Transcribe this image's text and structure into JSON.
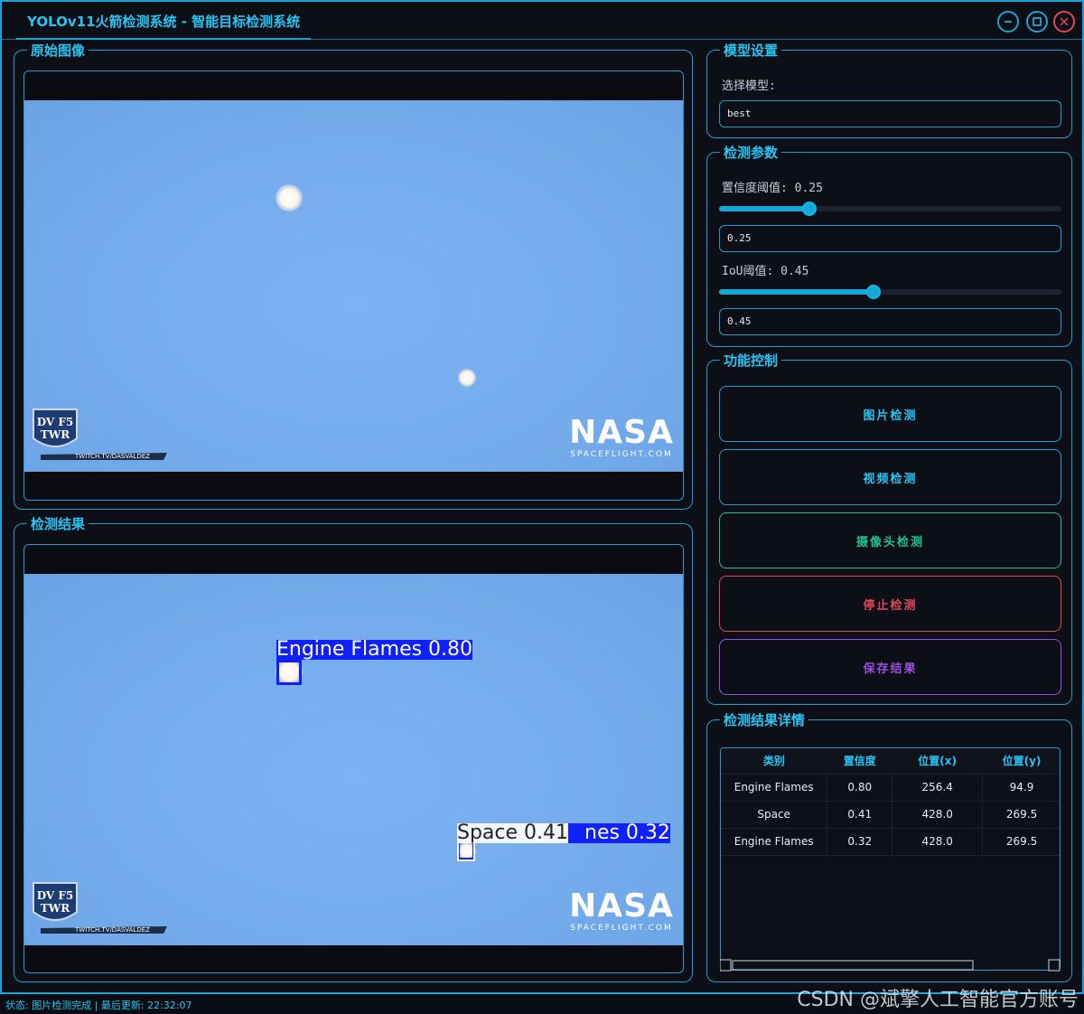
{
  "window": {
    "title": "YOLOv11火箭检测系统 - 智能目标检测系统"
  },
  "original_panel": {
    "title": "原始图像"
  },
  "result_panel": {
    "title": "检测结果"
  },
  "scene": {
    "badge_line1": "DV F5",
    "badge_line2": "TWR",
    "badge_sub": "TWITCH.TV/DASVALDEZ",
    "nasa_word": "NASA",
    "nasa_sub": "SPACEFLIGHT.COM"
  },
  "detections_overlay": [
    {
      "label": "Engine Flames 0.80",
      "color": "#1020ff"
    },
    {
      "label": "Space 0.41",
      "color": "#ffffff"
    },
    {
      "label": "Engine Flames 0.32",
      "color": "#1020ff",
      "visible_text": "nes 0.32"
    }
  ],
  "model_settings": {
    "title": "模型设置",
    "select_label": "选择模型:",
    "model_value": "best"
  },
  "detection_params": {
    "title": "检测参数",
    "confidence_label": "置信度阈值: 0.25",
    "confidence_value": 0.25,
    "confidence_input": "0.25",
    "iou_label": "IoU阈值: 0.45",
    "iou_value": 0.45,
    "iou_input": "0.45"
  },
  "controls": {
    "title": "功能控制",
    "buttons": [
      {
        "label": "图片检测",
        "color": "#1a9fd0"
      },
      {
        "label": "视频检测",
        "color": "#1a9fd0"
      },
      {
        "label": "摄像头检测",
        "color": "#1fc28a"
      },
      {
        "label": "停止检测",
        "color": "#e0475a"
      },
      {
        "label": "保存结果",
        "color": "#9a4fe0"
      }
    ]
  },
  "details": {
    "title": "检测结果详情",
    "columns": [
      "类别",
      "置信度",
      "位置(x)",
      "位置(y)"
    ],
    "rows": [
      [
        "Engine Flames",
        "0.80",
        "256.4",
        "94.9"
      ],
      [
        "Space",
        "0.41",
        "428.0",
        "269.5"
      ],
      [
        "Engine Flames",
        "0.32",
        "428.0",
        "269.5"
      ]
    ]
  },
  "status": {
    "text": "状态: 图片检测完成 | 最后更新: 22:32:07"
  },
  "watermark": "CSDN @斌擎人工智能官方账号"
}
